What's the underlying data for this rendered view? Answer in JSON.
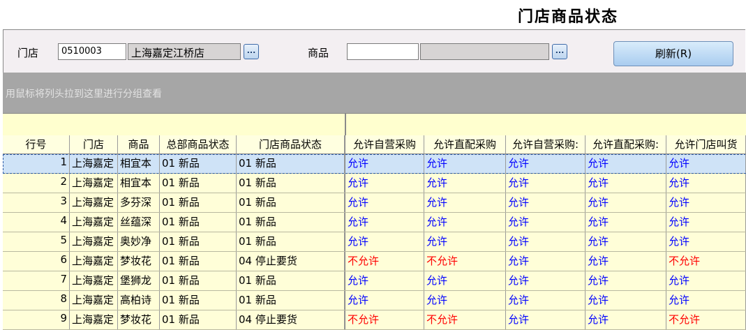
{
  "window_title": "门店商品状态",
  "toolbar": {
    "store_label": "门店",
    "store_code": "0510003",
    "store_name": "上海嘉定江桥店",
    "store_lookup_label": "...",
    "product_label": "商品",
    "product_code": "",
    "product_name": "",
    "product_lookup_label": "...",
    "refresh_label": "刷新(R)"
  },
  "group_hint": "用鼠标将列头拉到这里进行分组查看",
  "columns": [
    "行号",
    "门店",
    "商品",
    "总部商品状态",
    "门店商品状态",
    "允许自营采购",
    "允许直配采购",
    "允许自营采购:",
    "允许直配采购:",
    "允许门店叫货"
  ],
  "rows": [
    {
      "no": "1",
      "store": "上海嘉定",
      "product": "相宜本",
      "hq_status": "01 新品",
      "store_status": "01 新品",
      "p1": "允许",
      "p2": "允许",
      "p3": "允许",
      "p4": "允许",
      "p5": "允许"
    },
    {
      "no": "2",
      "store": "上海嘉定",
      "product": "相宜本",
      "hq_status": "01 新品",
      "store_status": "01 新品",
      "p1": "允许",
      "p2": "允许",
      "p3": "允许",
      "p4": "允许",
      "p5": "允许"
    },
    {
      "no": "3",
      "store": "上海嘉定",
      "product": "多芬深",
      "hq_status": "01 新品",
      "store_status": "01 新品",
      "p1": "允许",
      "p2": "允许",
      "p3": "允许",
      "p4": "允许",
      "p5": "允许"
    },
    {
      "no": "4",
      "store": "上海嘉定",
      "product": "丝蕴深",
      "hq_status": "01 新品",
      "store_status": "01 新品",
      "p1": "允许",
      "p2": "允许",
      "p3": "允许",
      "p4": "允许",
      "p5": "允许"
    },
    {
      "no": "5",
      "store": "上海嘉定",
      "product": "奥妙净",
      "hq_status": "01 新品",
      "store_status": "01 新品",
      "p1": "允许",
      "p2": "允许",
      "p3": "允许",
      "p4": "允许",
      "p5": "允许"
    },
    {
      "no": "6",
      "store": "上海嘉定",
      "product": "梦妆花",
      "hq_status": "01 新品",
      "store_status": "04 停止要货",
      "p1": "不允许",
      "p2": "不允许",
      "p3": "允许",
      "p4": "允许",
      "p5": "不允许"
    },
    {
      "no": "7",
      "store": "上海嘉定",
      "product": "堡狮龙",
      "hq_status": "01 新品",
      "store_status": "01 新品",
      "p1": "允许",
      "p2": "允许",
      "p3": "允许",
      "p4": "允许",
      "p5": "允许"
    },
    {
      "no": "8",
      "store": "上海嘉定",
      "product": "高柏诗",
      "hq_status": "01 新品",
      "store_status": "01 新品",
      "p1": "允许",
      "p2": "允许",
      "p3": "允许",
      "p4": "允许",
      "p5": "允许"
    },
    {
      "no": "9",
      "store": "上海嘉定",
      "product": "梦妆花",
      "hq_status": "01 新品",
      "store_status": "04 停止要货",
      "p1": "不允许",
      "p2": "不允许",
      "p3": "允许",
      "p4": "允许",
      "p5": "不允许"
    }
  ],
  "colors": {
    "allowed": "#0000ff",
    "denied": "#ff0000",
    "row_bg": "#fffed8",
    "selected_bg": "#cfe3f7",
    "group_bar": "#a6a6a6"
  }
}
